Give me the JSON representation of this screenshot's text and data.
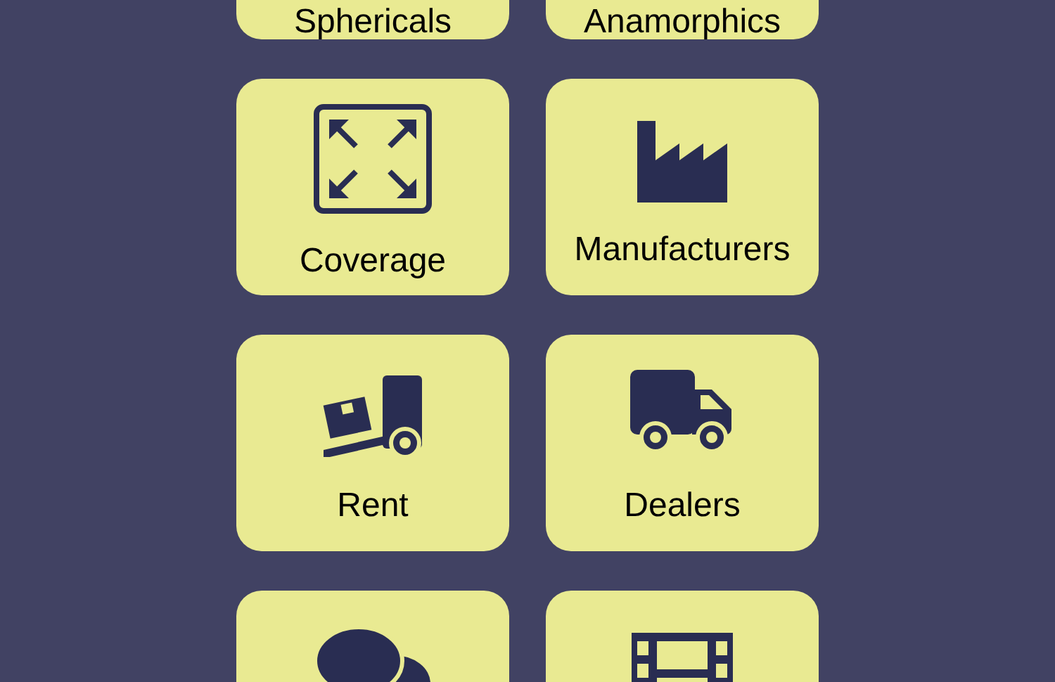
{
  "tiles": [
    {
      "label": "Sphericals"
    },
    {
      "label": "Anamorphics"
    },
    {
      "label": "Coverage",
      "kind": "expand"
    },
    {
      "label": "Manufacturers",
      "kind": "factory"
    },
    {
      "label": "Rent",
      "kind": "dolly"
    },
    {
      "label": "Dealers",
      "kind": "truck"
    },
    {
      "kind": "chat"
    },
    {
      "kind": "film"
    }
  ]
}
